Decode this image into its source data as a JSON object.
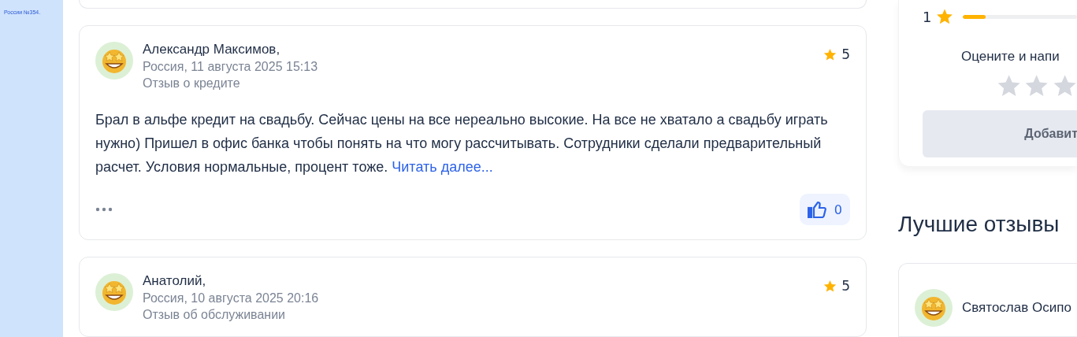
{
  "sidebar": {
    "note": "России №354."
  },
  "reviews": [
    {
      "author": "Александр Максимов,",
      "meta": "Россия, 11 августа 2025 15:13",
      "topic": "Отзыв о кредите",
      "rating": "5",
      "text": "Брал в альфе кредит на свадьбу. Сейчас цены на все нереально высокие. На все не хватало а свадьбу играть нужно) Пришел в офис банка чтобы понять на что могу рассчитывать. Сотрудники сделали предварительный расчет. Условия нормальные, процент тоже.",
      "read_more": "Читать далее...",
      "likes": "0"
    },
    {
      "author": "Анатолий,",
      "meta": "Россия, 10 августа 2025 20:16",
      "topic": "Отзыв об обслуживании",
      "rating": "5"
    }
  ],
  "rating_panel": {
    "bar": {
      "label": "1",
      "level": 0.2
    },
    "prompt": "Оцените и напи",
    "stars": 0,
    "button": "Добавит"
  },
  "best_reviews": {
    "title": "Лучшие отзывы",
    "items": [
      {
        "author": "Святослав Осипо"
      }
    ]
  }
}
